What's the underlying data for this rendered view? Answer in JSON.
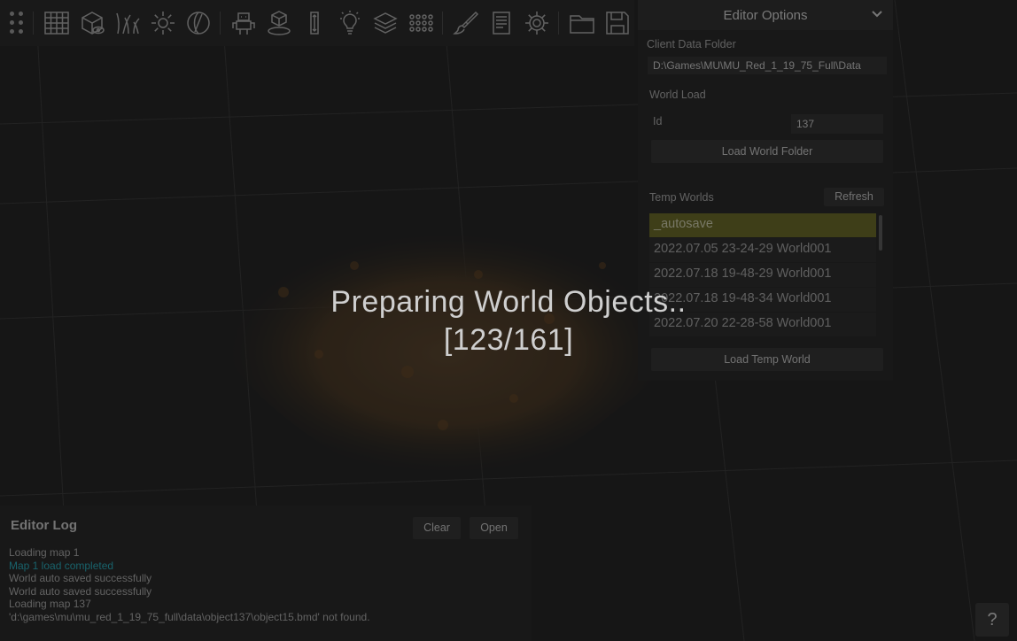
{
  "toolbar": {
    "icons": [
      "grid-icon",
      "cube-eye-icon",
      "grass-icon",
      "sun-icon",
      "sphere-icon",
      "robot-icon",
      "box-place-icon",
      "height-icon",
      "bulb-icon",
      "layers-icon",
      "dots-grid-icon",
      "brush-icon",
      "document-icon",
      "gear-icon",
      "folder-icon",
      "save-icon"
    ]
  },
  "options": {
    "title": "Editor Options",
    "client_data_label": "Client Data Folder",
    "client_data_value": "D:\\Games\\MU\\MU_Red_1_19_75_Full\\Data",
    "world_load_label": "World Load",
    "id_label": "Id",
    "id_value": "137",
    "load_world_folder": "Load World Folder",
    "temp_worlds_label": "Temp Worlds",
    "refresh": "Refresh",
    "temp_worlds": [
      "_autosave",
      "2022.07.05 23-24-29 World001",
      "2022.07.18 19-48-29 World001",
      "2022.07.18 19-48-34 World001",
      "2022.07.20 22-28-58 World001"
    ],
    "selected_index": 0,
    "load_temp_world": "Load Temp World"
  },
  "log": {
    "title": "Editor Log",
    "clear": "Clear",
    "open": "Open",
    "lines": [
      {
        "text": "Loading map 1",
        "type": "info"
      },
      {
        "text": "Map 1 load completed",
        "type": "success"
      },
      {
        "text": "World auto saved successfully",
        "type": "info"
      },
      {
        "text": "World auto saved successfully",
        "type": "info"
      },
      {
        "text": "Loading map 137",
        "type": "info"
      },
      {
        "text": "'d:\\games\\mu\\mu_red_1_19_75_full\\data\\object137\\object15.bmd' not found.",
        "type": "info"
      }
    ]
  },
  "loading": {
    "line1": "Preparing World Objects..",
    "line2": "[123/161]"
  },
  "help": "?",
  "colors": {
    "accent_success": "#2aa9b8",
    "selected_row": "#6b6b2a"
  }
}
